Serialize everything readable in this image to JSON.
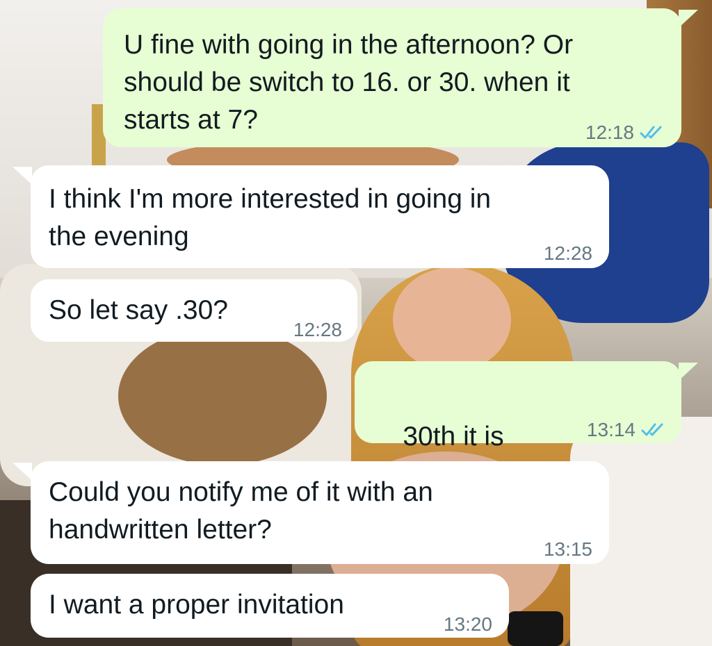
{
  "messages": [
    {
      "direction": "outgoing",
      "text": "U fine with going in the afternoon? Or\nshould be switch to 16. or 30. when it\nstarts at 7?",
      "time": "12:18",
      "status": "read"
    },
    {
      "direction": "incoming",
      "text": "I think I'm more interested in going in\nthe evening",
      "time": "12:28"
    },
    {
      "direction": "incoming",
      "text": "So let say .30?",
      "time": "12:28"
    },
    {
      "direction": "outgoing",
      "text": "30th it is",
      "emoji": "✨",
      "time": "13:14",
      "status": "read"
    },
    {
      "direction": "incoming",
      "text": "Could you notify me of it with an\nhandwritten letter?",
      "time": "13:15"
    },
    {
      "direction": "incoming",
      "text": "I want a proper invitation",
      "time": "13:20"
    }
  ],
  "colors": {
    "outgoing_bubble": "#e7fdd3",
    "incoming_bubble": "#ffffff",
    "text": "#111b21",
    "timestamp": "#667781",
    "read_ticks": "#53bdeb"
  },
  "icons": {
    "read_receipt": "double-check-icon",
    "sparkles": "sparkles-icon"
  }
}
